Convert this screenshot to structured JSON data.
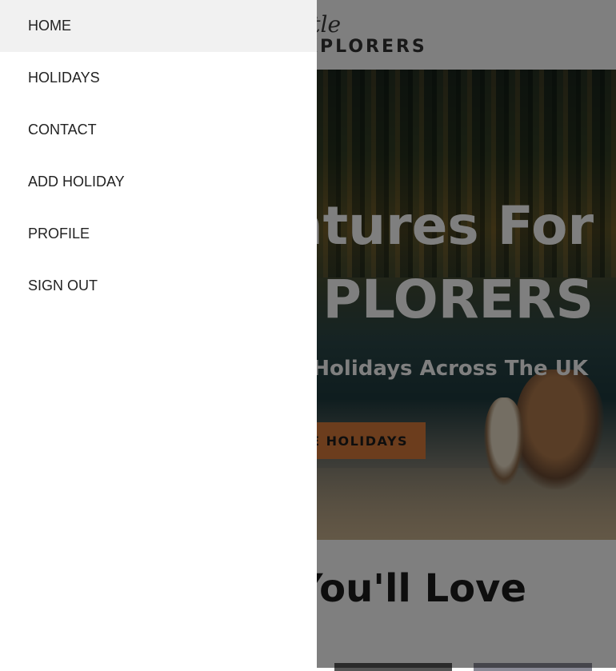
{
  "logo": {
    "script_text": "ttle",
    "word_text": "XPLORERS"
  },
  "hero": {
    "title_line1": "ntures For",
    "title_line2": "PLORERS",
    "subtitle": "Holidays Across The UK",
    "button_label": "E HOLIDAYS"
  },
  "section": {
    "title": "You'll Love"
  },
  "menu": {
    "items": [
      {
        "label": "HOME",
        "active": true
      },
      {
        "label": "HOLIDAYS"
      },
      {
        "label": "CONTACT"
      },
      {
        "label": "ADD HOLIDAY"
      },
      {
        "label": "PROFILE"
      },
      {
        "label": "SIGN OUT"
      }
    ]
  },
  "colors": {
    "accent": "#d97a3a",
    "overlay": "rgba(0,0,0,0.5)",
    "active_item_bg": "#f1f1f1"
  }
}
